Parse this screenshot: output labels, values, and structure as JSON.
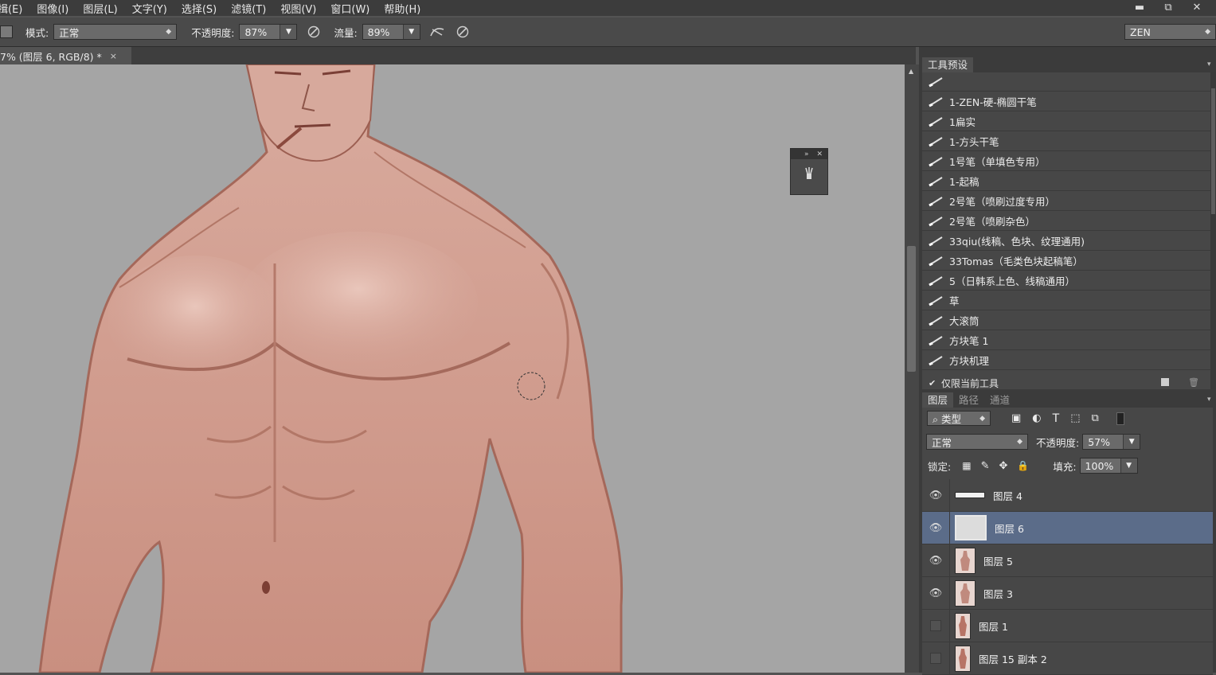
{
  "menubar": {
    "items": [
      "揖(E)",
      "图像(I)",
      "图层(L)",
      "文字(Y)",
      "选择(S)",
      "滤镜(T)",
      "视图(V)",
      "窗口(W)",
      "帮助(H)"
    ],
    "min": "▬",
    "restore": "⧉",
    "close": "✕"
  },
  "options": {
    "mode_label": "模式:",
    "mode_value": "正常",
    "opacity_label": "不透明度:",
    "opacity_value": "87%",
    "flow_label": "流量:",
    "flow_value": "89%",
    "workspace": "ZEN"
  },
  "document": {
    "tab_title": "7% (图层 6, RGB/8) *",
    "close": "×"
  },
  "tool_presets": {
    "panel_title": "工具预设",
    "items": [
      "",
      "1-ZEN-硬-椭圆干笔",
      "1扁实",
      "1-方头干笔",
      "1号笔（单填色专用）",
      "1-起稿",
      "2号笔（喷刷过度专用）",
      "2号笔（喷刷杂色）",
      "33qiu(线稿、色块、纹理通用)",
      "33Tomas（毛类色块起稿笔）",
      "5（日韩系上色、线稿通用）",
      "草",
      "大滚筒",
      "方块笔 1",
      "方块机理"
    ],
    "current_only_label": "仅限当前工具",
    "current_only_checked": true
  },
  "layers_panel": {
    "tabs": [
      "图层",
      "路径",
      "通道"
    ],
    "active_tab": "图层",
    "filter_label": "类型",
    "blend_mode": "正常",
    "opacity_label": "不透明度:",
    "opacity_value": "57%",
    "lock_label": "锁定:",
    "fill_label": "填充:",
    "fill_value": "100%",
    "layers": [
      {
        "name": "图层 4",
        "visible": true,
        "selected": false,
        "thumb": "strip"
      },
      {
        "name": "图层 6",
        "visible": true,
        "selected": true,
        "thumb": "blank"
      },
      {
        "name": "图层 5",
        "visible": true,
        "selected": false,
        "thumb": "figure"
      },
      {
        "name": "图层 3",
        "visible": true,
        "selected": false,
        "thumb": "figure"
      },
      {
        "name": "图层 1",
        "visible": false,
        "selected": false,
        "thumb": "figure"
      },
      {
        "name": "图层 15 副本 2",
        "visible": false,
        "selected": false,
        "thumb": "figure"
      }
    ]
  },
  "colors": {
    "accent_selected": "#5b6c89",
    "canvas_bg": "#a5a5a5",
    "skin": "#d6a598"
  }
}
